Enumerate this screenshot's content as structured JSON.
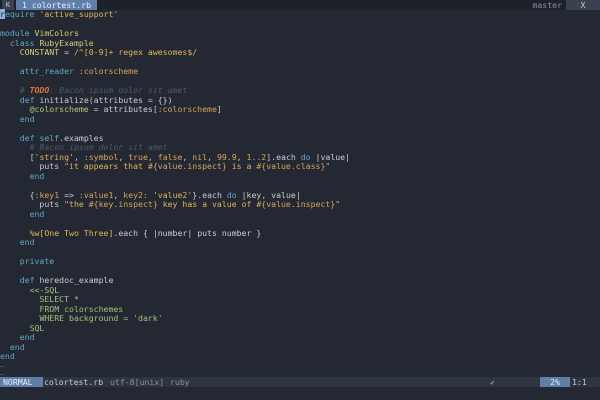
{
  "tabline": {
    "left_glyph": "K",
    "tab_label": "1 colortest.rb",
    "branch": "master",
    "right_glyph": "X"
  },
  "code": [
    "require 'active_support'",
    "",
    "module VimColors",
    "  class RubyExample",
    "    CONSTANT = /^[0-9]+ regex awesomes$/",
    "",
    "    attr_reader :colorscheme",
    "",
    "    # TODO: Bacon ipsum dolor sit amet",
    "    def initialize(attributes = {})",
    "      @colorscheme = attributes[:colorscheme]",
    "    end",
    "",
    "    def self.examples",
    "      # Bacon ipsum dolor sit amet",
    "      ['string', :symbol, true, false, nil, 99.9, 1..2].each do |value|",
    "        puts \"it appears that #{value.inspect} is a #{value.class}\"",
    "      end",
    "",
    "      {:key1 => :value1, key2: 'value2'}.each do |key, value|",
    "        puts \"the #{key.inspect} key has a value of #{value.inspect}\"",
    "      end",
    "",
    "      %w[One Two Three].each { |number| puts number }",
    "    end",
    "",
    "    private",
    "",
    "    def heredoc_example",
    "      <<-SQL",
    "        SELECT *",
    "        FROM colorschemes",
    "        WHERE background = 'dark'",
    "      SQL",
    "    end",
    "  end",
    "end"
  ],
  "tilde_lines": [
    "~",
    "~",
    "~",
    "~",
    "~"
  ],
  "statusline": {
    "mode": "NORMAL",
    "file": "colortest.rb",
    "encoding": "utf-8[unix]",
    "filetype": "ruby",
    "check": "✔",
    "percent": "2%",
    "position": "1:1"
  }
}
